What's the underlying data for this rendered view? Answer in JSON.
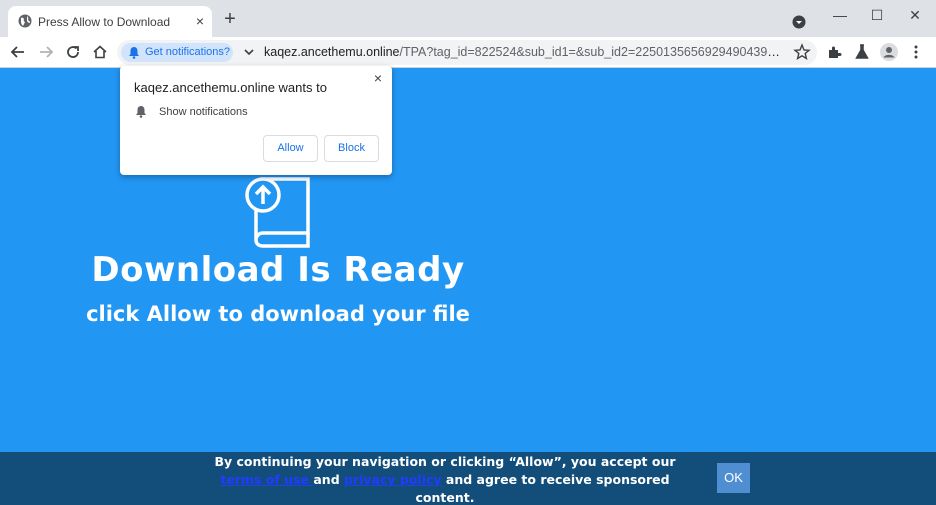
{
  "browser": {
    "tab_title": "Press Allow to Download",
    "tab_close": "×",
    "new_tab": "+",
    "window": {
      "minimize": "—",
      "maximize": "☐",
      "close": "✕"
    },
    "notif_chip_label": "Get notifications?",
    "url_host": "kaqez.ancethemu.online",
    "url_path": "/TPA?tag_id=822524&sub_id1=&sub_id2=2250135656929490439&cooki...",
    "icons": [
      "globe-icon",
      "search-tabs-icon",
      "back-icon",
      "forward-icon",
      "reload-icon",
      "home-icon",
      "bell-icon",
      "chevron-down-icon",
      "star-icon",
      "extensions-icon",
      "labs-icon",
      "profile-icon",
      "menu-icon"
    ]
  },
  "popup": {
    "title": "kaqez.ancethemu.online wants to",
    "close": "×",
    "permission": "Show notifications",
    "allow_label": "Allow",
    "block_label": "Block"
  },
  "main": {
    "headline": "Download Is Ready",
    "subline": "click Allow to download your file",
    "background_color": "#2196f3"
  },
  "bottom_bar": {
    "text_1": "By continuing your navigation or clicking “Allow”, you accept our ",
    "terms_link": "terms of use ",
    "text_2": "and ",
    "privacy_link": "privacy policy",
    "text_3": " and agree to receive sponsored content.",
    "ok_label": "OK"
  }
}
